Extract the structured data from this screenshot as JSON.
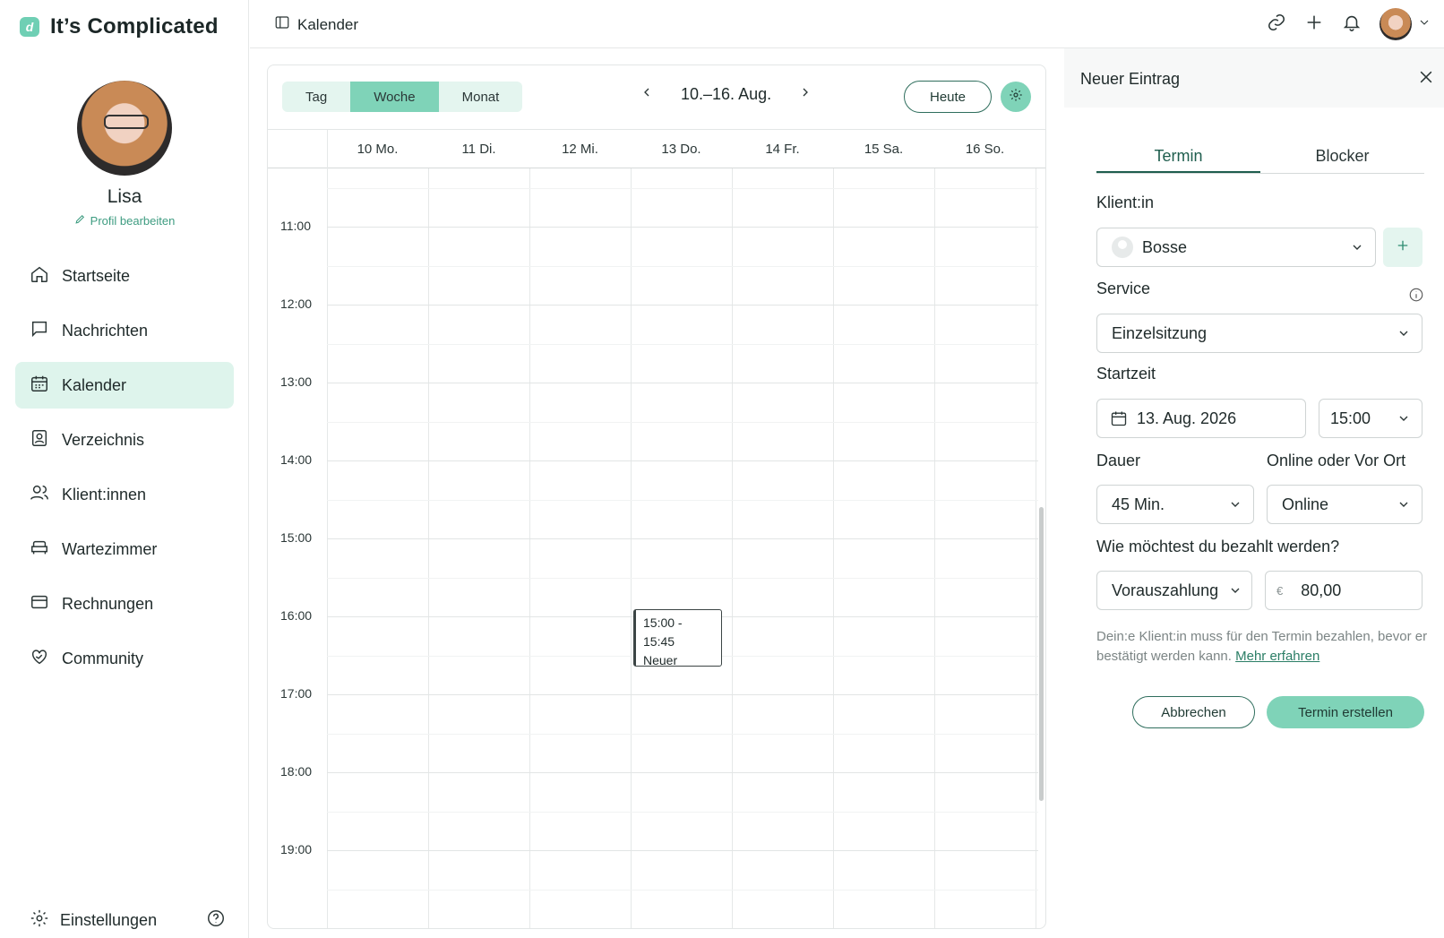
{
  "brand": {
    "name": "It’s Complicated",
    "logo_letter": "d"
  },
  "profile": {
    "name": "Lisa",
    "edit_label": "Profil bearbeiten"
  },
  "nav": {
    "items": [
      {
        "label": "Startseite",
        "icon": "home-icon"
      },
      {
        "label": "Nachrichten",
        "icon": "message-icon"
      },
      {
        "label": "Kalender",
        "icon": "calendar-icon",
        "active": true
      },
      {
        "label": "Verzeichnis",
        "icon": "directory-icon"
      },
      {
        "label": "Klient:innen",
        "icon": "users-icon"
      },
      {
        "label": "Wartezimmer",
        "icon": "waiting-room-icon"
      },
      {
        "label": "Rechnungen",
        "icon": "credit-card-icon"
      },
      {
        "label": "Community",
        "icon": "heart-hands-icon"
      }
    ],
    "settings_label": "Einstellungen"
  },
  "topbar": {
    "title": "Kalender"
  },
  "calendar": {
    "views": [
      "Tag",
      "Woche",
      "Monat"
    ],
    "active_view": "Woche",
    "range": "10.–16. Aug.",
    "today_label": "Heute",
    "days": [
      "10 Mo.",
      "11 Di.",
      "12 Mi.",
      "13 Do.",
      "14 Fr.",
      "15 Sa.",
      "16 So."
    ],
    "hours": [
      "11:00",
      "12:00",
      "13:00",
      "14:00",
      "15:00",
      "16:00",
      "17:00",
      "18:00",
      "19:00"
    ],
    "event": {
      "time": "15:00 - 15:45",
      "title": "Neuer"
    }
  },
  "panel": {
    "title": "Neuer Eintrag",
    "tabs": [
      "Termin",
      "Blocker"
    ],
    "client_label": "Klient:in",
    "client_value": "Bosse",
    "service_label": "Service",
    "service_value": "Einzelsitzung",
    "start_label": "Startzeit",
    "start_date": "13. Aug. 2026",
    "start_time": "15:00",
    "duration_label": "Dauer",
    "duration_value": "45 Min.",
    "location_label": "Online oder Vor Ort",
    "location_value": "Online",
    "payment_label": "Wie möchtest du bezahlt werden?",
    "payment_method": "Vorauszahlung",
    "currency": "€",
    "amount": "80,00",
    "hint": "Dein:e Klient:in muss für den Termin bezahlen, bevor er bestätigt werden kann.",
    "hint_link": "Mehr erfahren",
    "cancel_label": "Abbrechen",
    "create_label": "Termin erstellen"
  },
  "colors": {
    "accent": "#7fd3b8",
    "accent_light": "#e4f5ef",
    "accent_dark": "#2f6e5d"
  }
}
